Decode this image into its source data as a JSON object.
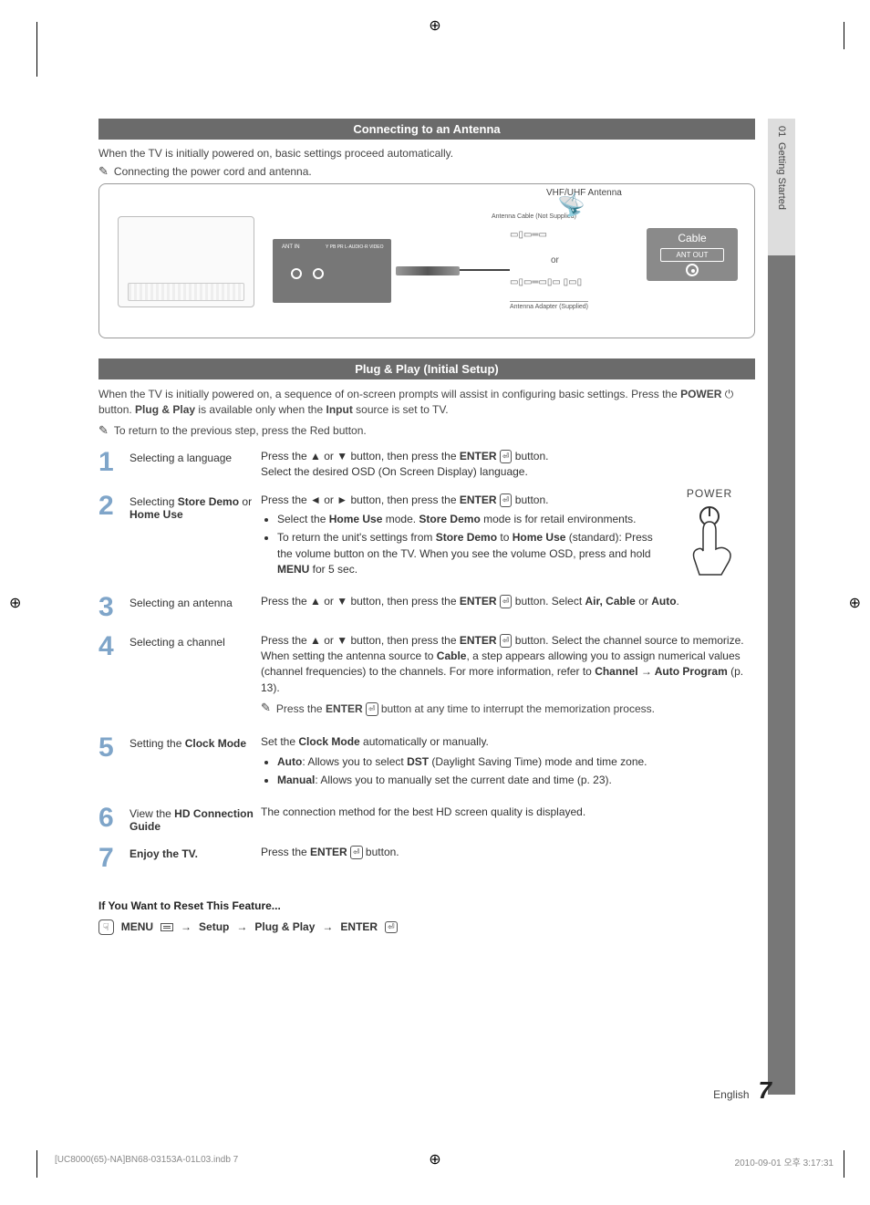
{
  "side_tab": {
    "chapter_num": "01",
    "chapter_title": "Getting Started"
  },
  "section1": {
    "title": "Connecting to an Antenna",
    "intro": "When the TV is initially powered on, basic settings proceed automatically.",
    "note": "Connecting the power cord and antenna."
  },
  "diagram": {
    "vhf_label": "VHF/UHF Antenna",
    "antenna_cable": "Antenna Cable (Not Supplied)",
    "or": "or",
    "adapter_label": "Antenna Adapter (Supplied)",
    "cable_box": "Cable",
    "ant_out": "ANT OUT",
    "panel_lbl1": "ANT IN",
    "panel_lbl2": "Y  PB  PR  L-AUDIO-R  VIDEO"
  },
  "section2": {
    "title": "Plug & Play (Initial Setup)",
    "intro_a": "When the TV is initially powered on, a sequence of on-screen prompts will assist in configuring basic settings. Press the ",
    "intro_b": "POWER",
    "intro_c": " button. ",
    "intro_d": "Plug & Play",
    "intro_e": " is available only when the ",
    "intro_f": "Input",
    "intro_g": " source is set to TV.",
    "note": "To return to the previous step, press the Red button."
  },
  "power": {
    "label": "POWER"
  },
  "steps": [
    {
      "num": "1",
      "title": "Selecting a language",
      "body_parts": {
        "a": "Press the ▲ or ▼ button, then press the ",
        "b": "ENTER",
        "c": " button.",
        "d": "Select the desired OSD (On Screen Display) language."
      }
    },
    {
      "num": "2",
      "title_a": "Selecting ",
      "title_b": "Store Demo",
      "title_c": " or ",
      "title_d": "Home Use",
      "body_parts": {
        "a": "Press the ◄ or ► button, then press the ",
        "b": "ENTER",
        "c": " button.",
        "li1a": "Select the ",
        "li1b": "Home Use",
        "li1c": " mode. ",
        "li1d": "Store Demo",
        "li1e": " mode is for retail environments.",
        "li2a": "To return the unit's settings from ",
        "li2b": "Store Demo",
        "li2c": " to ",
        "li2d": "Home Use",
        "li2e": " (standard): Press the volume button on the TV. When you see the volume OSD, press and hold ",
        "li2f": "MENU",
        "li2g": " for 5 sec."
      }
    },
    {
      "num": "3",
      "title": "Selecting an antenna",
      "body_parts": {
        "a": "Press the ▲ or ▼ button, then press the ",
        "b": "ENTER",
        "c": " button. Select ",
        "d": "Air, Cable",
        "e": " or ",
        "f": "Auto",
        "g": "."
      }
    },
    {
      "num": "4",
      "title": "Selecting a channel",
      "body_parts": {
        "a": "Press the ▲ or ▼ button, then press the ",
        "b": "ENTER",
        "c": " button. Select the channel source to memorize. When setting the antenna source to ",
        "d": "Cable",
        "e": ", a step appears allowing you to assign numerical values (channel frequencies) to the channels. For more information, refer to ",
        "f": "Channel → Auto Program",
        "g": " (p. 13).",
        "note_a": "Press the ",
        "note_b": "ENTER",
        "note_c": " button at any time to interrupt the memorization process."
      }
    },
    {
      "num": "5",
      "title_a": "Setting the ",
      "title_b": "Clock Mode",
      "body_parts": {
        "a": "Set the ",
        "b": "Clock Mode",
        "c": " automatically or manually.",
        "li1a": "Auto",
        "li1b": ": Allows you to select ",
        "li1c": "DST",
        "li1d": " (Daylight Saving Time) mode and time zone.",
        "li2a": "Manual",
        "li2b": ": Allows you to manually set the current date and time (p. 23)."
      }
    },
    {
      "num": "6",
      "title_a": "View the ",
      "title_b": "HD Connection Guide",
      "body": "The connection method for the best HD screen quality is displayed."
    },
    {
      "num": "7",
      "title": "Enjoy the TV.",
      "body_a": "Press the ",
      "body_b": "ENTER",
      "body_c": " button."
    }
  ],
  "reset": {
    "header": "If You Want to Reset This Feature...",
    "menu": "MENU",
    "arrow": "→",
    "setup": "Setup",
    "pp": "Plug & Play",
    "enter": "ENTER"
  },
  "footer": {
    "lang": "English",
    "page": "7"
  },
  "print": {
    "left": "[UC8000(65)-NA]BN68-03153A-01L03.indb   7",
    "right": "2010-09-01   오후 3:17:31"
  }
}
